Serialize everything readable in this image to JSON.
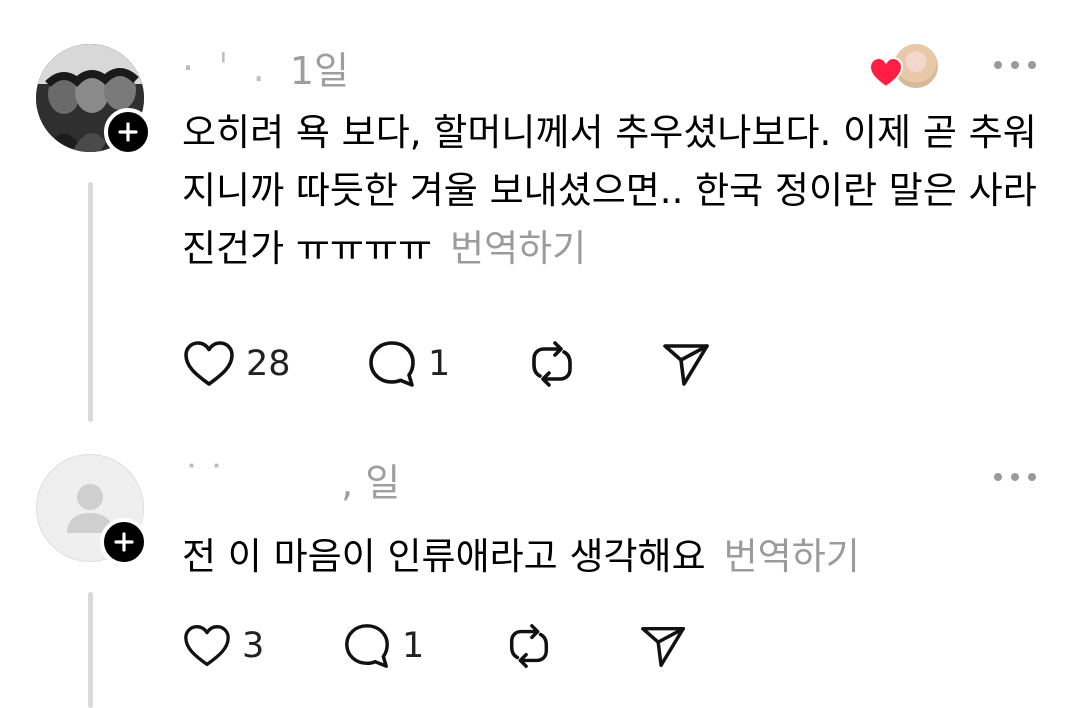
{
  "posts": [
    {
      "username": "·  ˈ   .",
      "time": "1일",
      "text": "오히려 욕 보다, 할머니께서 추우셨나보다. 이제 곧 추워지니까 따듯한 겨울 보내셨으면.. 한국 정이란 말은 사라진건가 ㅠㅠㅠㅠ",
      "translate_label": "번역하기",
      "likes": "28",
      "replies": "1",
      "liked_by_author": true
    },
    {
      "username": "˙˙",
      "time": ", 일",
      "text": "전 이 마음이 인류애라고 생각해요",
      "translate_label": "번역하기",
      "likes": "3",
      "replies": "1",
      "liked_by_author": false
    }
  ],
  "icons": {
    "like": "heart-outline-icon",
    "reply": "speech-bubble-icon",
    "repost": "repost-icon",
    "share": "send-icon",
    "more": "more-horizontal-icon",
    "follow": "plus-icon"
  },
  "colors": {
    "liked_heart": "#ff1f44",
    "muted_text": "#9b9b9b",
    "thread_line": "#d9d9d9"
  }
}
